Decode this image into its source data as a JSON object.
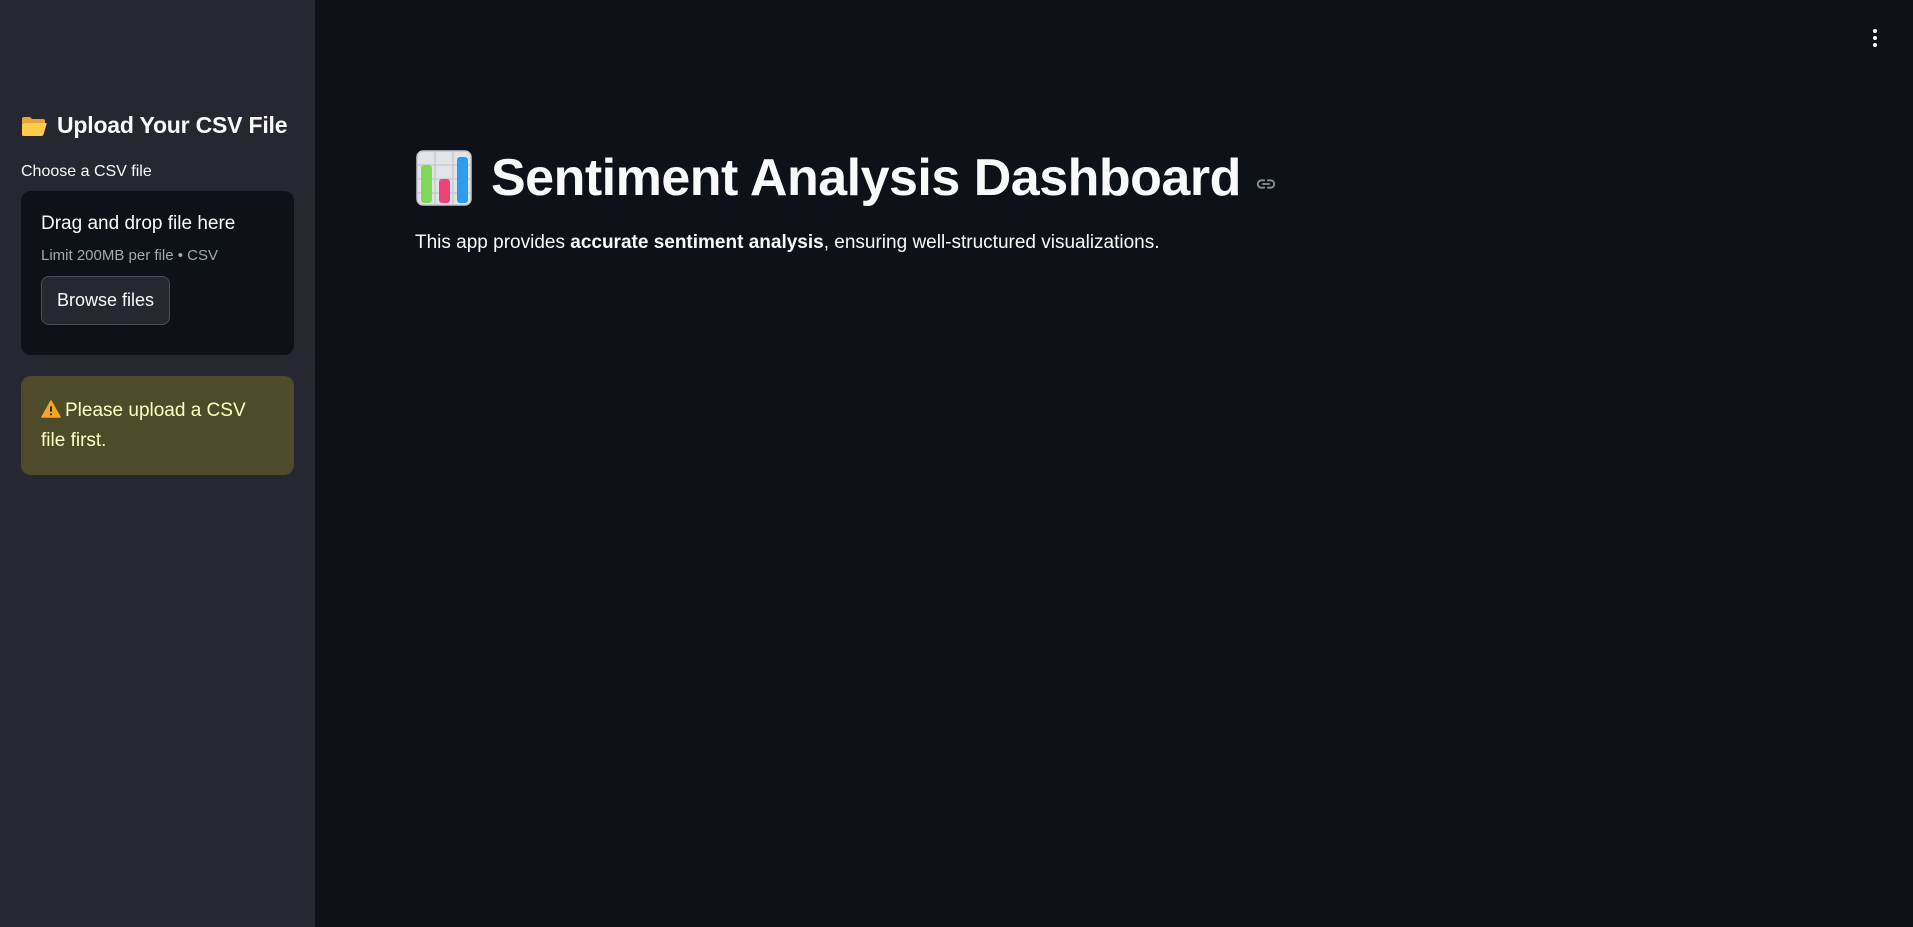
{
  "sidebar": {
    "header": "Upload Your CSV File",
    "uploader_label": "Choose a CSV file",
    "dropzone_title": "Drag and drop file here",
    "dropzone_limit": "Limit 200MB per file • CSV",
    "browse_label": "Browse files",
    "warning_text": "Please upload a CSV file first."
  },
  "main": {
    "title": "Sentiment Analysis Dashboard",
    "description_before": "This app provides ",
    "description_bold": "accurate sentiment analysis",
    "description_after": ", ensuring well-structured visualizations."
  },
  "icons": {
    "folder": "folder-icon",
    "warning": "warning-icon",
    "chart": "bar-chart-icon",
    "link": "link-icon",
    "menu": "vertical-dots-icon"
  },
  "colors": {
    "main_bg": "#0e1117",
    "sidebar_bg": "#262730",
    "warning_bg": "#4e4b2a",
    "warning_text": "#ffffc2"
  }
}
